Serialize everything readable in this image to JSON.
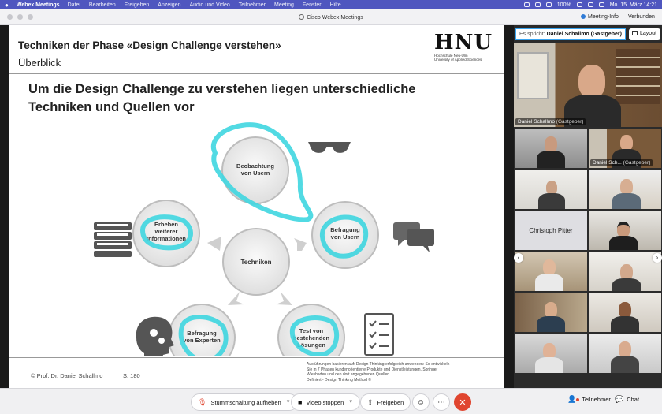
{
  "menubar": {
    "app_name": "Webex Meetings",
    "items": [
      "Datei",
      "Bearbeiten",
      "Freigeben",
      "Anzeigen",
      "Audio und Video",
      "Teilnehmer",
      "Meeting",
      "Fenster",
      "Hilfe"
    ],
    "battery": "100%",
    "datetime": "Mo. 15. März 14:21"
  },
  "window": {
    "title": "Cisco Webex Meetings",
    "meeting_info": "Meeting-Info",
    "status": "Verbunden"
  },
  "slide": {
    "title": "Techniken der Phase «Design Challenge verstehen»",
    "subtitle": "Überblick",
    "logo_text": "HNU",
    "logo_sub": [
      "Hochschule Neu-Ulm",
      "University of Applied Sciences"
    ],
    "headline_1": "Um die Design Challenge zu verstehen liegen unterschiedliche",
    "headline_2": "Techniken und Quellen vor",
    "center_label": "Techniken",
    "nodes": [
      {
        "id": "beobachtung",
        "line1": "Beobachtung",
        "line2": "von Usern",
        "line3": ""
      },
      {
        "id": "befragung-user",
        "line1": "Befragung",
        "line2": "von Usern",
        "line3": ""
      },
      {
        "id": "test",
        "line1": "Test von",
        "line2": "bestehenden",
        "line3": "Lösungen"
      },
      {
        "id": "befragung-experten",
        "line1": "Befragung",
        "line2": "von Experten",
        "line3": ""
      },
      {
        "id": "erheben",
        "line1": "Erheben",
        "line2": "weiterer",
        "line3": "Informationen"
      }
    ],
    "footer_author": "© Prof. Dr. Daniel Schallmo",
    "footer_page": "S. 180",
    "footer_note": [
      "Ausführungen basieren auf: Design Thinking erfolgreich anwenden: So entwickeln",
      "Sie in 7 Phasen kundenorientierte Produkte und Dienstleistungen, Springer",
      "Wiesbaden und den dort angegebenen Quellen.",
      "Definiert - Design Thinking Method ©"
    ]
  },
  "panel": {
    "speaking_label": "Es spricht:",
    "speaking_name": "Daniel Schallmo (Gastgeber)",
    "layout_label": "Layout",
    "main_video": {
      "name": "Daniel Schallmo",
      "role": "(Gastgeber)"
    },
    "tiles": [
      {
        "name": "",
        "role": ""
      },
      {
        "name": "Daniel Sch...",
        "role": "(Gastgeber)"
      },
      {
        "name": "",
        "role": ""
      },
      {
        "name": "",
        "role": ""
      },
      {
        "name": "Christoph Pitter",
        "role": ""
      },
      {
        "name": "",
        "role": ""
      },
      {
        "name": "",
        "role": ""
      },
      {
        "name": "",
        "role": ""
      },
      {
        "name": "",
        "role": ""
      },
      {
        "name": "",
        "role": ""
      },
      {
        "name": "",
        "role": ""
      },
      {
        "name": "",
        "role": ""
      }
    ]
  },
  "controls": {
    "mute": "Stummschaltung aufheben",
    "video": "Video stoppen",
    "share": "Freigeben",
    "participants": "Teilnehmer",
    "chat": "Chat"
  },
  "colors": {
    "highlight": "#3fd6e0",
    "menubar": "#4f56bf",
    "end_call": "#e0452f",
    "active_speaker": "#3aa5f0"
  }
}
